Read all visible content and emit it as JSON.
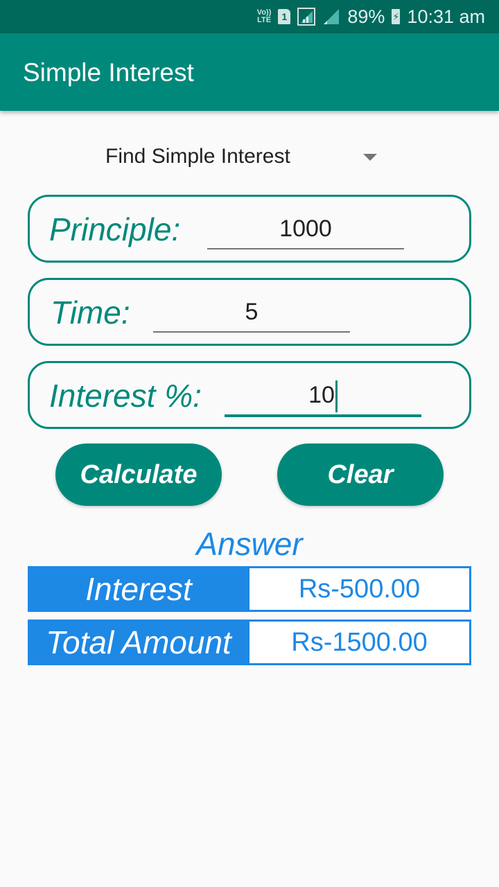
{
  "status_bar": {
    "volte_label": "Vo)) LTE",
    "sim_label": "1",
    "battery_percent": "89%",
    "time": "10:31 am"
  },
  "app_bar": {
    "title": "Simple Interest"
  },
  "mode_spinner": {
    "selected": "Find Simple Interest"
  },
  "fields": {
    "principle": {
      "label": "Principle:",
      "value": "1000"
    },
    "time": {
      "label": "Time:",
      "value": "5"
    },
    "interest": {
      "label": "Interest %:",
      "value": "10"
    }
  },
  "buttons": {
    "calculate": "Calculate",
    "clear": "Clear"
  },
  "answer": {
    "heading": "Answer",
    "rows": [
      {
        "label": "Interest",
        "value": "Rs-500.00"
      },
      {
        "label": "Total Amount",
        "value": "Rs-1500.00"
      }
    ]
  },
  "colors": {
    "primary": "#00897b",
    "primary_dark": "#00695c",
    "answer_blue": "#1e88e5"
  }
}
